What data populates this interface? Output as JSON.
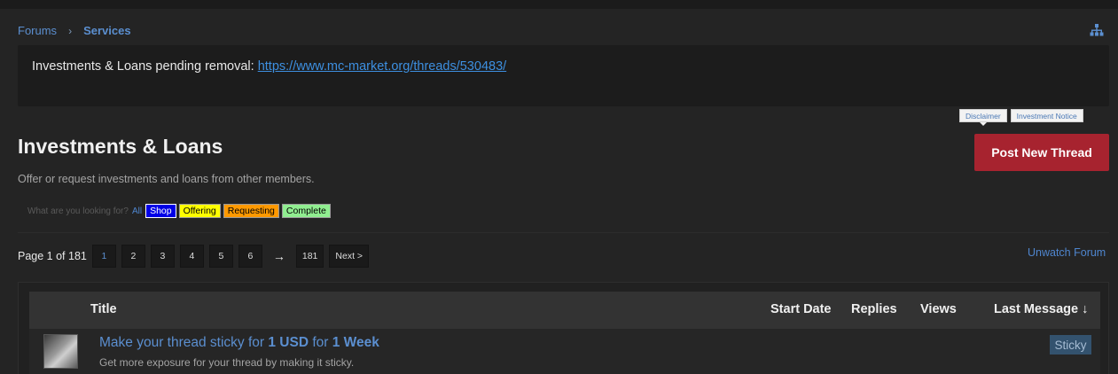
{
  "breadcrumb": {
    "forums": "Forums",
    "separator": "›",
    "current": "Services"
  },
  "notice": {
    "text": "Investments & Loans pending removal: ",
    "link": "https://www.mc-market.org/threads/530483/"
  },
  "header_tags": {
    "disclaimer": "Disclaimer",
    "investment_notice": "Investment Notice"
  },
  "forum": {
    "title": "Investments & Loans",
    "description": "Offer or request investments and loans from other members."
  },
  "post_button": "Post New Thread",
  "filters": {
    "label": "What are you looking for?",
    "all": "All",
    "shop": "Shop",
    "offering": "Offering",
    "requesting": "Requesting",
    "complete": "Complete"
  },
  "pager": {
    "info": "Page 1 of 181",
    "pages": [
      "1",
      "2",
      "3",
      "4",
      "5",
      "6"
    ],
    "arrow": "→",
    "last": "181",
    "next": "Next >"
  },
  "unwatch": "Unwatch Forum",
  "table": {
    "headers": {
      "title": "Title",
      "start_date": "Start Date",
      "replies": "Replies",
      "views": "Views",
      "last_message": "Last Message ↓"
    },
    "rows": [
      {
        "title_pre": "Make your thread sticky for ",
        "title_price": "1 USD",
        "title_mid": " for ",
        "title_duration": "1 Week",
        "subtitle": "Get more exposure for your thread by making it sticky.",
        "badge": "Sticky"
      }
    ]
  },
  "icons": {
    "sitemap": "sitemap-icon"
  },
  "colors": {
    "accent": "#5b8fd0",
    "post_button": "#a7232f",
    "background": "#242424"
  }
}
